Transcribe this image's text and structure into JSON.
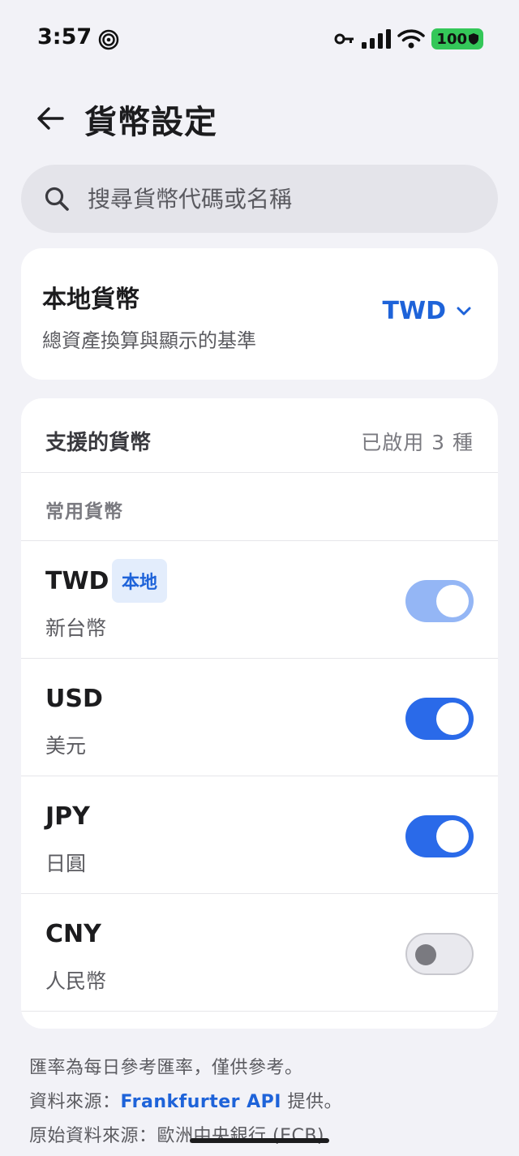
{
  "status_bar": {
    "time": "3:57",
    "battery": "100",
    "icons": [
      "spiral-icon",
      "key-icon",
      "signal-icon",
      "wifi-icon",
      "battery-icon"
    ]
  },
  "header": {
    "title": "貨幣設定",
    "back_icon": "arrow-left-icon"
  },
  "search": {
    "placeholder": "搜尋貨幣代碼或名稱",
    "icon": "search-icon"
  },
  "local_currency": {
    "title": "本地貨幣",
    "subtitle": "總資產換算與顯示的基準",
    "selected": "TWD",
    "icon": "chevron-down-icon"
  },
  "supported": {
    "title": "支援的貨幣",
    "count": "已啟用 3 種",
    "section_label": "常用貨幣",
    "currencies": [
      {
        "code": "TWD",
        "name": "新台幣",
        "badge": "本地",
        "enabled": true,
        "locked": true
      },
      {
        "code": "USD",
        "name": "美元",
        "enabled": true
      },
      {
        "code": "JPY",
        "name": "日圓",
        "enabled": true
      },
      {
        "code": "CNY",
        "name": "人民幣",
        "enabled": false
      }
    ]
  },
  "footer": {
    "line1": "匯率為每日參考匯率，僅供參考。",
    "line2_prefix": "資料來源：",
    "line2_link": "Frankfurter API",
    "line2_suffix": " 提供。",
    "line3": "原始資料來源：歐洲中央銀行 (ECB)"
  },
  "colors": {
    "accent": "#1e63d9",
    "toggle_on": "#2a6ae9",
    "toggle_locked": "#94b6f5",
    "background": "#f2f2f7"
  }
}
